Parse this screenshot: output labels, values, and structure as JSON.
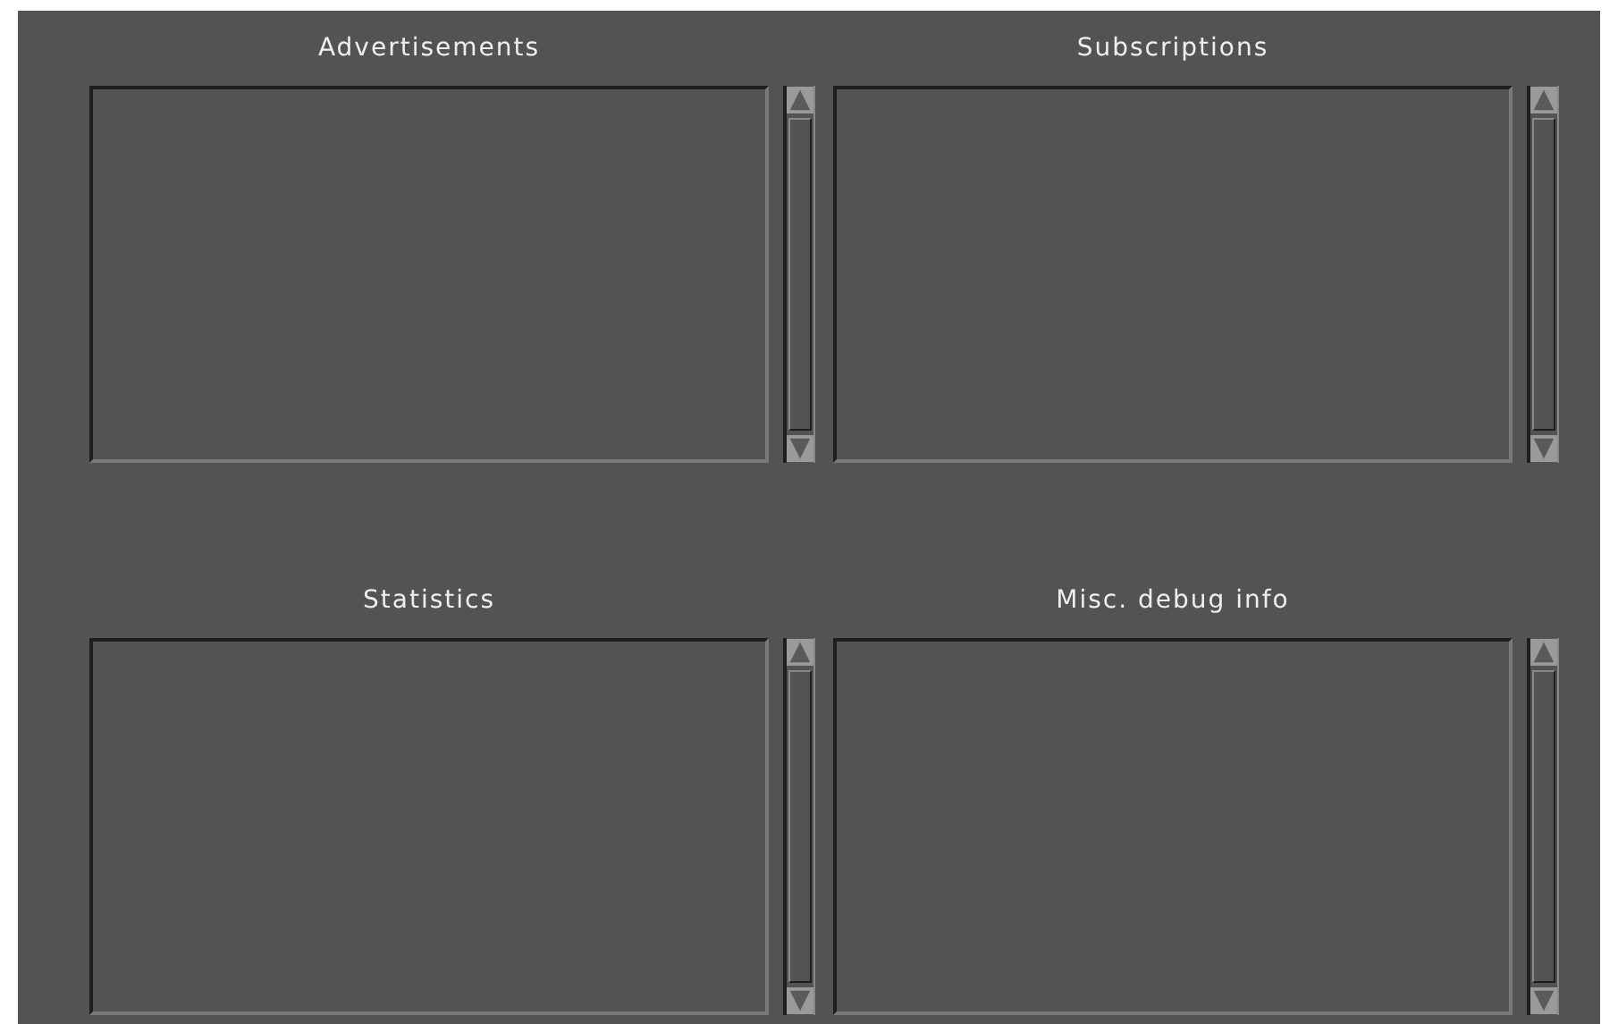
{
  "panes": [
    {
      "title": "Advertisements"
    },
    {
      "title": "Subscriptions"
    },
    {
      "title": "Statistics"
    },
    {
      "title": "Misc. debug info"
    }
  ]
}
